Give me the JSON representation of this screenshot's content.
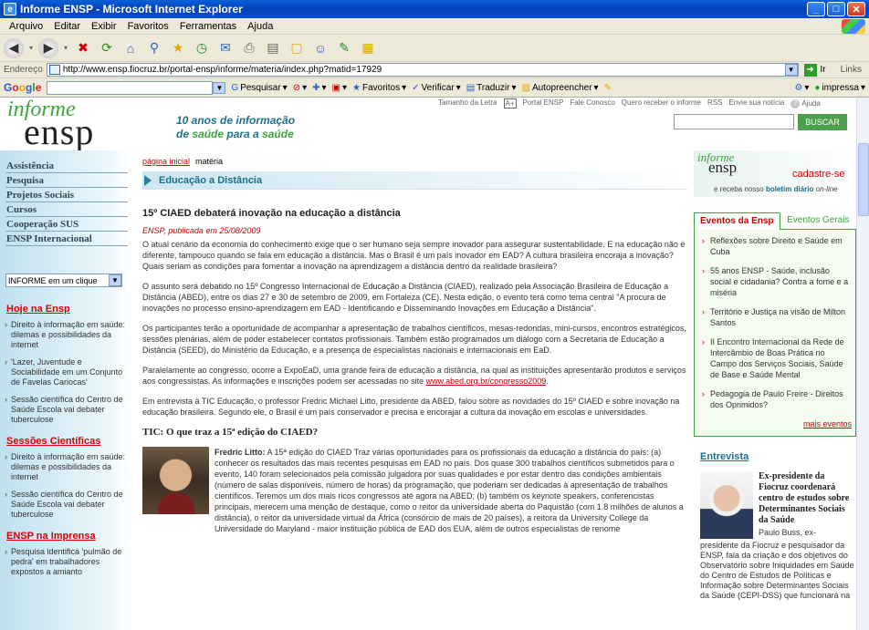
{
  "window": {
    "title": "Informe ENSP - Microsoft Internet Explorer"
  },
  "menu": [
    "Arquivo",
    "Editar",
    "Exibir",
    "Favoritos",
    "Ferramentas",
    "Ajuda"
  ],
  "address": {
    "label": "Endereço",
    "url": "http://www.ensp.fiocruz.br/portal-ensp/informe/materia/index.php?matid=17929",
    "go": "Ir",
    "links": "Links"
  },
  "googlebar": {
    "pesquisar": "Pesquisar",
    "favoritos": "Favoritos",
    "verificar": "Verificar",
    "traduzir": "Traduzir",
    "autopreencher": "Autopreencher",
    "impressa": "impressa"
  },
  "site": {
    "logo_top": "informe",
    "logo_bottom": "ensp",
    "slogan_line1": "10 anos de informação",
    "slogan_line2_a": "de ",
    "slogan_line2_b": "saúde",
    "slogan_line2_c": " para a ",
    "slogan_line2_d": "saúde",
    "toplinks": [
      "Tamanho da Letra",
      "Portal ENSP",
      "Fale Conosco",
      "Quero receber o informe",
      "RSS",
      "Envie sua notícia",
      "Ajuda"
    ],
    "aa": "A+",
    "search_button": "BUSCAR"
  },
  "leftnav": {
    "items": [
      "Assistência",
      "Pesquisa",
      "Projetos Sociais",
      "Cursos",
      "Cooperação SUS",
      "ENSP Internacional"
    ],
    "select": "INFORME em um clique",
    "sections": [
      {
        "title": "Hoje na Ensp",
        "items": [
          "Direito à informação em saúde: dilemas e possibilidades da internet",
          "'Lazer, Juventude e Sociabilidade em um Conjunto de Favelas Cariocas'",
          "Sessão científica do Centro de Saúde Escola vai debater tuberculose"
        ]
      },
      {
        "title": "Sessões Científicas",
        "items": [
          "Direito à informação em saúde: dilemas e possibilidades da internet",
          "Sessão científica do Centro de Saúde Escola vai debater tuberculose"
        ]
      },
      {
        "title": "ENSP na Imprensa",
        "items": [
          "Pesquisa identifica 'pulmão de pedra' em trabalhadores expostos a amianto"
        ]
      }
    ]
  },
  "main": {
    "crumb_home": "página inicial",
    "crumb_current": "matéria",
    "section": "Educação a Distância",
    "headline": "15º CIAED debaterá inovação na educação a distância",
    "pubdate": "ENSP, publicada em 25/08/2009",
    "paragraphs": [
      "O atual cenário da economia do conhecimento exige que o ser humano seja sempre inovador para assegurar sustentabilidade. E na educação não é diferente, tampouco quando se fala em educação a distância. Mas o Brasil é um país inovador em EAD? A cultura brasileira encoraja a inovação? Quais seriam as condições para fomentar a inovação na aprendizagem a distância dentro da realidade brasileira?",
      "O assunto será debatido no 15º Congresso Internacional de Educação a Distância (CIAED), realizado pela Associação Brasileira de Educação a Distância (ABED), entre os dias 27 e 30 de setembro de 2009, em Fortaleza (CE). Nesta edição, o evento terá como tema central \"A procura de inovações no processo ensino-aprendizagem em EAD - Identificando e Disseminando Inovações em Educação a Distância\".",
      "Os participantes terão a oportunidade de acompanhar a apresentação de trabalhos científicos, mesas-redondas, mini-cursos, encontros estratégicos, sessões plenárias, além de poder estabelecer contatos profissionais. Também estão programados um diálogo com a Secretaria de Educação a Distância (SEED), do Ministério da Educação, e a presença de especialistas nacionais e internacionais em EaD."
    ],
    "para4_text": "Paralelamente ao congresso, ocorre a ExpoEaD, uma grande feira de educação a distância, na qual as instituições apresentarão produtos e serviços aos congressistas. As informações e inscrições podem ser acessadas no site ",
    "para4_link": "www.abed.org.br/congresso2009",
    "para4_end": ".",
    "para5": "Em entrevista à TIC Educação, o professor Fredric Michael Litto, presidente da ABED, falou sobre as novidades do 15º CIAED e sobre inovação na educação brasileira. Segundo ele, o Brasil é um país conservador e precisa e encorajar a cultura da inovação em escolas e universidades.",
    "subhead": "TIC: O que traz a 15ª edição do CIAED?",
    "interview_name": "Fredric Litto:",
    "interview_text": " A 15ª edição do CIAED Traz várias oportunidades para os profissionais da educação a distância do país: (a) conhecer os resultados das mais recentes pesquisas em EAD no país. Dos quase 300 trabalhos científicos submetidos para o evento, 140 foram selecionados pela comissão julgadora por suas qualidades e por estar dentro das condições ambientais (número de salas disponíveis, número de horas) da programação, que poderiam ser dedicadas à apresentação de trabalhos científicos. Teremos um dos mais ricos congressos até agora na ABED; (b) também os keynote speakers, conferencistas principais, merecem uma menção de destaque, como o reitor da universidade aberta do Paquistão (com 1.8 milhões de alunos a distância), o reitor da universidade virtual da África (consórcio de mais de 20 países), a reitora da University College da Universidade do Maryland - maior instituição pública de EAD dos EUA, além de outros especialistas de renome"
  },
  "right": {
    "banner_top": "informe",
    "banner_bottom": "ensp",
    "cadastre": "cadastre-se",
    "rec_a": "e receba nosso ",
    "rec_b": "boletim diário",
    "rec_c": " on-line",
    "tab_active": "Eventos da Ensp",
    "tab_inactive": "Eventos Gerais",
    "events": [
      "Reflexões sobre Direito e Saúde em Cuba",
      "55 anos ENSP - Saúde, inclusão social e cidadania? Contra a fome e a miséria",
      "Território e Justiça na visão de Milton Santos",
      "II Encontro Internacional da Rede de Intercâmbio de Boas Prática no Campo dos Serviços Sociais, Saúde de Base e Saúde Mental",
      "Pedagogia de Paulo Freire - Direitos dos Oprimidos?"
    ],
    "more_events": "mais eventos",
    "entrevista": "Entrevista",
    "entrev_title": "Ex-presidente da Fiocruz coordenará centro de estudos sobre Determinantes Sociais da Saúde",
    "entrev_lead": "Paulo Buss, ex-",
    "entrev_text": "presidente da Fiocruz e pesquisador da ENSP, fala da criação e dos objetivos do Observatório sobre Iniquidades em Saúde do Centro de Estudos de Políticas e Informação sobre Determinantes Sociais da Saúde (CEPI-DSS) que funcionará na"
  }
}
